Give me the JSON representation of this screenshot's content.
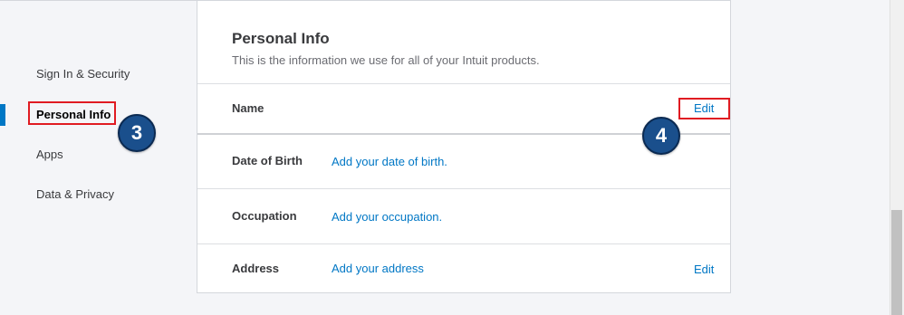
{
  "sidebar": {
    "items": [
      {
        "label": "Sign In & Security"
      },
      {
        "label": "Personal Info"
      },
      {
        "label": "Apps"
      },
      {
        "label": "Data & Privacy"
      }
    ],
    "active_index": 1,
    "step_badge": "3"
  },
  "card": {
    "title": "Personal Info",
    "subtitle": "This is the information we use for all of your Intuit products.",
    "rows": [
      {
        "label": "Name",
        "value": "",
        "edit": "Edit"
      },
      {
        "label": "Date of Birth",
        "value": "Add your date of birth.",
        "edit": ""
      },
      {
        "label": "Occupation",
        "value": "Add your occupation.",
        "edit": ""
      },
      {
        "label": "Address",
        "value": "Add your address",
        "edit": "Edit"
      }
    ],
    "step_badge": "4"
  },
  "colors": {
    "link": "#0077c5",
    "highlight": "#e01b22",
    "badge": "#1a4f8c",
    "active_bar": "#0077c5"
  }
}
